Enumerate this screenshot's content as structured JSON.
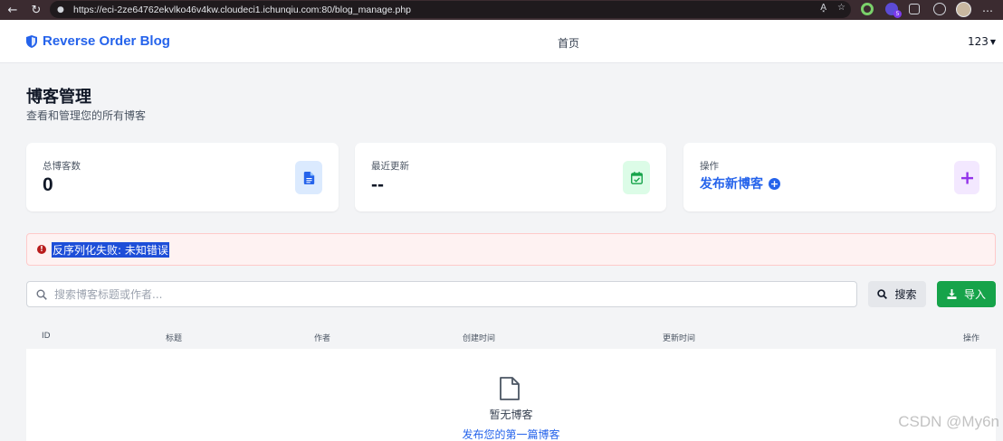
{
  "browser": {
    "url": "https://eci-2ze64762ekvlko46v4kw.cloudeci1.ichunqiu.com:80/blog_manage.php",
    "reader_label": "A͓"
  },
  "navbar": {
    "brand": "Reverse Order Blog",
    "home": "首页",
    "user": "123"
  },
  "header": {
    "title": "博客管理",
    "subtitle": "查看和管理您的所有博客"
  },
  "stats": {
    "total_label": "总博客数",
    "total_value": "0",
    "recent_label": "最近更新",
    "recent_value": "--",
    "action_label": "操作",
    "action_link": "发布新博客"
  },
  "alert": {
    "message": "反序列化失败: 未知错误"
  },
  "search": {
    "placeholder": "搜索博客标题或作者...",
    "value": "",
    "search_button": "搜索",
    "import_button": "导入"
  },
  "table": {
    "columns": [
      "ID",
      "标题",
      "作者",
      "创建时间",
      "更新时间",
      "操作"
    ],
    "empty_text": "暂无博客",
    "empty_link": "发布您的第一篇博客"
  },
  "watermark": "CSDN @My6n",
  "colors": {
    "primary": "#2563eb",
    "success": "#16a34a",
    "danger": "#b91c1c",
    "alert_bg": "#fef2f2"
  },
  "icons": {
    "brand": "shield-icon",
    "total": "document-icon",
    "recent": "calendar-check-icon",
    "action": "plus-icon",
    "search": "search-icon",
    "import": "download-icon",
    "empty": "file-outline-icon",
    "alert": "exclamation-circle-icon"
  }
}
